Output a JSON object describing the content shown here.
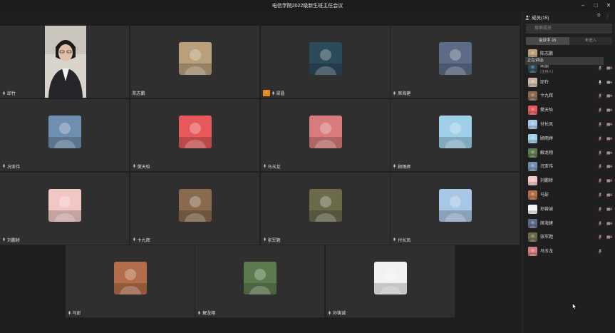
{
  "window": {
    "title": "电信学院2022级新生班主任会议",
    "minimize_icon": "minimize-icon",
    "maximize_icon": "maximize-icon",
    "close_icon": "close-icon"
  },
  "tiles": [
    {
      "name": "邱竹",
      "kind": "video",
      "mic": "on"
    },
    {
      "name": "陈志鹏",
      "kind": "avatar",
      "mic": "none",
      "color": "#b9a07a"
    },
    {
      "name": "梁晶",
      "kind": "avatar",
      "mic": "on",
      "share": true,
      "color": "#2b4a5a"
    },
    {
      "name": "席海建",
      "kind": "avatar",
      "mic": "on",
      "color": "#5c6c86"
    },
    {
      "name": "况亚伟",
      "kind": "avatar",
      "mic": "on",
      "color": "#6f8fb0"
    },
    {
      "name": "樊天怡",
      "kind": "avatar",
      "mic": "on",
      "color": "#e7585a"
    },
    {
      "name": "马玉龙",
      "kind": "avatar",
      "mic": "on",
      "color": "#d97a7c"
    },
    {
      "name": "顾雨婷",
      "kind": "avatar",
      "mic": "on",
      "color": "#9fd0e8"
    },
    {
      "name": "刘鹏轿",
      "kind": "avatar",
      "mic": "on",
      "color": "#f1c7c4"
    },
    {
      "name": "卞九辉",
      "kind": "avatar",
      "mic": "on",
      "color": "#8a6a4e"
    },
    {
      "name": "张军题",
      "kind": "avatar",
      "mic": "on",
      "color": "#6b6a4a"
    },
    {
      "name": "付长凤",
      "kind": "avatar",
      "mic": "on",
      "color": "#a8c6e6"
    },
    {
      "name": "马彭",
      "kind": "avatar",
      "mic": "on",
      "color": "#b46d4a"
    },
    {
      "name": "解龙翔",
      "kind": "avatar",
      "mic": "on",
      "color": "#5d7a4f"
    },
    {
      "name": "孙铸诚",
      "kind": "avatar",
      "mic": "on",
      "color": "#f2f2f2"
    }
  ],
  "sidebar": {
    "header": "成员(15)",
    "header_icons": [
      "popout-icon",
      "more-icon"
    ],
    "search_placeholder": "搜索成员",
    "tabs": [
      {
        "label": "会议中·15",
        "active": true
      },
      {
        "label": "未进入",
        "active": false
      }
    ],
    "speaking_label": "正在讲话:",
    "members": [
      {
        "name": "陈志鹏",
        "sub": "",
        "color": "#b9a07a",
        "mic": "",
        "cam": ""
      },
      {
        "name": "梁晶",
        "sub": "(主持人)",
        "color": "#2b4a5a",
        "mic": "muted",
        "cam": "off"
      },
      {
        "name": "邱竹",
        "sub": "",
        "color": "#c9b7a4",
        "mic": "on",
        "cam": "on"
      },
      {
        "name": "卞九辉",
        "sub": "",
        "color": "#8a6a4e",
        "mic": "muted",
        "cam": "off"
      },
      {
        "name": "樊天怡",
        "sub": "",
        "color": "#e7585a",
        "mic": "muted",
        "cam": "off"
      },
      {
        "name": "付长凤",
        "sub": "",
        "color": "#a8c6e6",
        "mic": "muted",
        "cam": "off"
      },
      {
        "name": "顾雨婷",
        "sub": "",
        "color": "#9fd0e8",
        "mic": "muted",
        "cam": "off"
      },
      {
        "name": "解龙翔",
        "sub": "",
        "color": "#5d7a4f",
        "mic": "muted",
        "cam": "off"
      },
      {
        "name": "况亚伟",
        "sub": "",
        "color": "#6f8fb0",
        "mic": "muted",
        "cam": "off"
      },
      {
        "name": "刘鹏轿",
        "sub": "",
        "color": "#f1c7c4",
        "mic": "muted",
        "cam": "off"
      },
      {
        "name": "马彭",
        "sub": "",
        "color": "#b46d4a",
        "mic": "muted",
        "cam": "off"
      },
      {
        "name": "孙铸诚",
        "sub": "",
        "color": "#f2f2f2",
        "mic": "muted",
        "cam": "off"
      },
      {
        "name": "席海建",
        "sub": "",
        "color": "#5c6c86",
        "mic": "muted",
        "cam": "off"
      },
      {
        "name": "张军题",
        "sub": "",
        "color": "#6b6a4a",
        "mic": "muted",
        "cam": "off"
      },
      {
        "name": "马玉龙",
        "sub": "",
        "color": "#d97a7c",
        "mic": "muted",
        "cam": ""
      }
    ]
  },
  "colors": {
    "tile_bg": "#2f2f2f",
    "sidebar_bg": "#1f1f1f",
    "share_badge": "#e58a1f"
  }
}
